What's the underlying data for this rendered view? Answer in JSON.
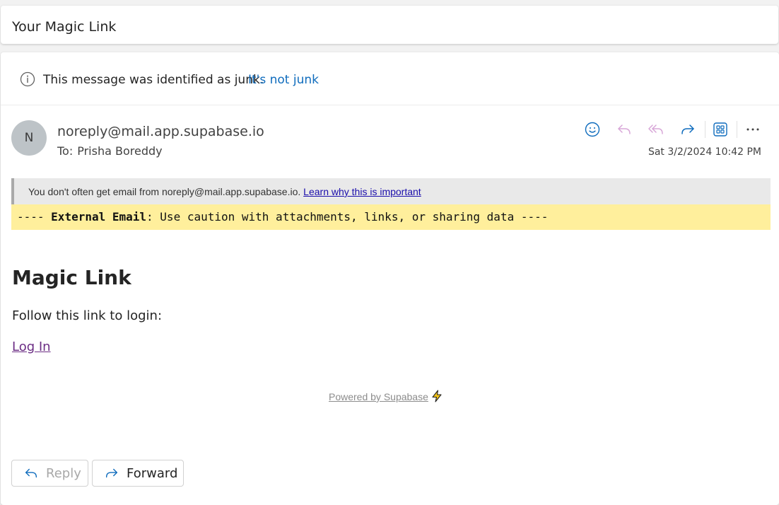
{
  "subject": "Your Magic Link",
  "junk_bar": {
    "message": "This message was identified as junk.",
    "not_junk_label": "It's not junk"
  },
  "header": {
    "avatar_initial": "N",
    "sender": "noreply@mail.app.supabase.io",
    "to_label": "To:",
    "recipient": "Prisha Boreddy",
    "timestamp": "Sat 3/2/2024 10:42 PM",
    "actions": [
      "emoji-icon",
      "reply-icon",
      "reply-all-icon",
      "forward-icon",
      "apps-icon",
      "more-icon"
    ]
  },
  "notices": {
    "gray_text": "You don't often get email from noreply@mail.app.supabase.io.",
    "gray_link": "Learn why this is important",
    "yellow_prefix": "---- ",
    "yellow_bold": "External Email",
    "yellow_rest": ": Use caution with attachments, links, or sharing data ----"
  },
  "body": {
    "heading": "Magic Link",
    "text": "Follow this link to login:",
    "link": "Log In",
    "footer": "Powered by Supabase"
  },
  "buttons": {
    "reply": "Reply",
    "forward": "Forward"
  },
  "colors": {
    "link_blue": "#0f6cbd",
    "warning_yellow": "#ffef9c",
    "visited_purple": "#6b2d84"
  }
}
